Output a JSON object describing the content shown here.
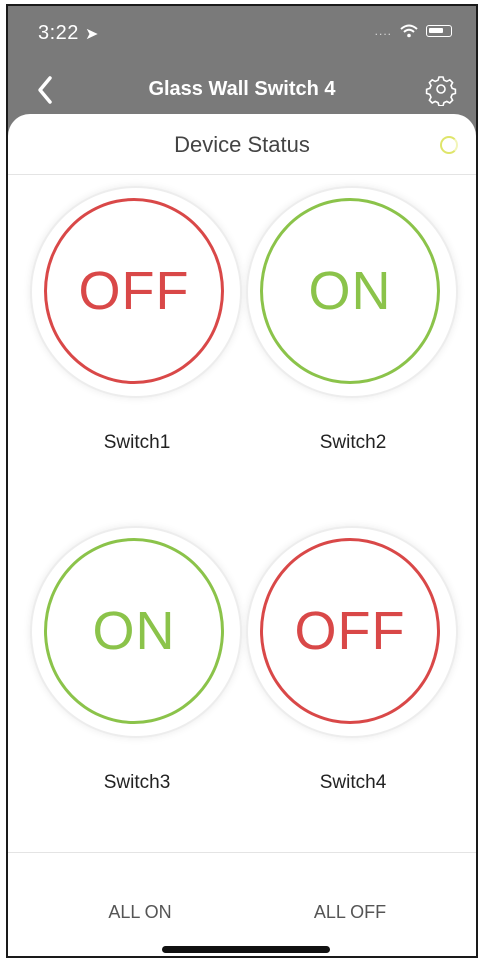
{
  "status_bar": {
    "time": "3:22",
    "location_arrow": "➤",
    "signal": "....",
    "wifi_icon": "wifi-icon",
    "battery_icon": "battery-icon"
  },
  "nav": {
    "title": "Glass Wall Switch 4",
    "back_icon": "chevron-left-icon",
    "settings_icon": "gear-icon"
  },
  "device_status": {
    "title": "Device Status",
    "loading_icon": "loading-ring-icon",
    "colors": {
      "off": "#d94848",
      "on": "#8bc34a"
    },
    "switches": [
      {
        "name": "Switch1",
        "state": "OFF"
      },
      {
        "name": "Switch2",
        "state": "ON"
      },
      {
        "name": "Switch3",
        "state": "ON"
      },
      {
        "name": "Switch4",
        "state": "OFF"
      }
    ]
  },
  "footer": {
    "all_on": "ALL ON",
    "all_off": "ALL OFF"
  }
}
